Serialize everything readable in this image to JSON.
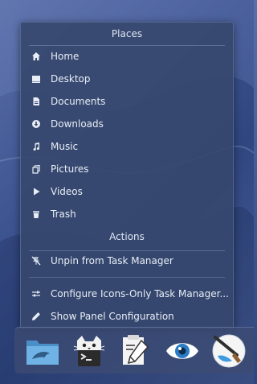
{
  "places": {
    "header": "Places",
    "items": [
      {
        "label": "Home",
        "icon": "home-icon"
      },
      {
        "label": "Desktop",
        "icon": "desktop-icon"
      },
      {
        "label": "Documents",
        "icon": "documents-icon"
      },
      {
        "label": "Downloads",
        "icon": "downloads-icon"
      },
      {
        "label": "Music",
        "icon": "music-icon"
      },
      {
        "label": "Pictures",
        "icon": "pictures-icon"
      },
      {
        "label": "Videos",
        "icon": "videos-icon"
      },
      {
        "label": "Trash",
        "icon": "trash-icon"
      }
    ]
  },
  "actions": {
    "header": "Actions",
    "unpin": {
      "label": "Unpin from Task Manager",
      "icon": "unpin-icon"
    },
    "configure": {
      "label": "Configure Icons-Only Task Manager...",
      "icon": "configure-icon"
    },
    "panel": {
      "label": "Show Panel Configuration",
      "icon": "pencil-icon"
    }
  },
  "taskbar": {
    "apps": [
      {
        "icon": "file-manager-icon"
      },
      {
        "icon": "terminal-cat-icon"
      },
      {
        "icon": "text-editor-icon"
      },
      {
        "icon": "image-viewer-eye-icon"
      },
      {
        "icon": "paint-brush-icon"
      }
    ]
  },
  "colors": {
    "menu_bg": "#36486e",
    "text": "#e8edf6",
    "folder_blue": "#5aa3dc"
  }
}
